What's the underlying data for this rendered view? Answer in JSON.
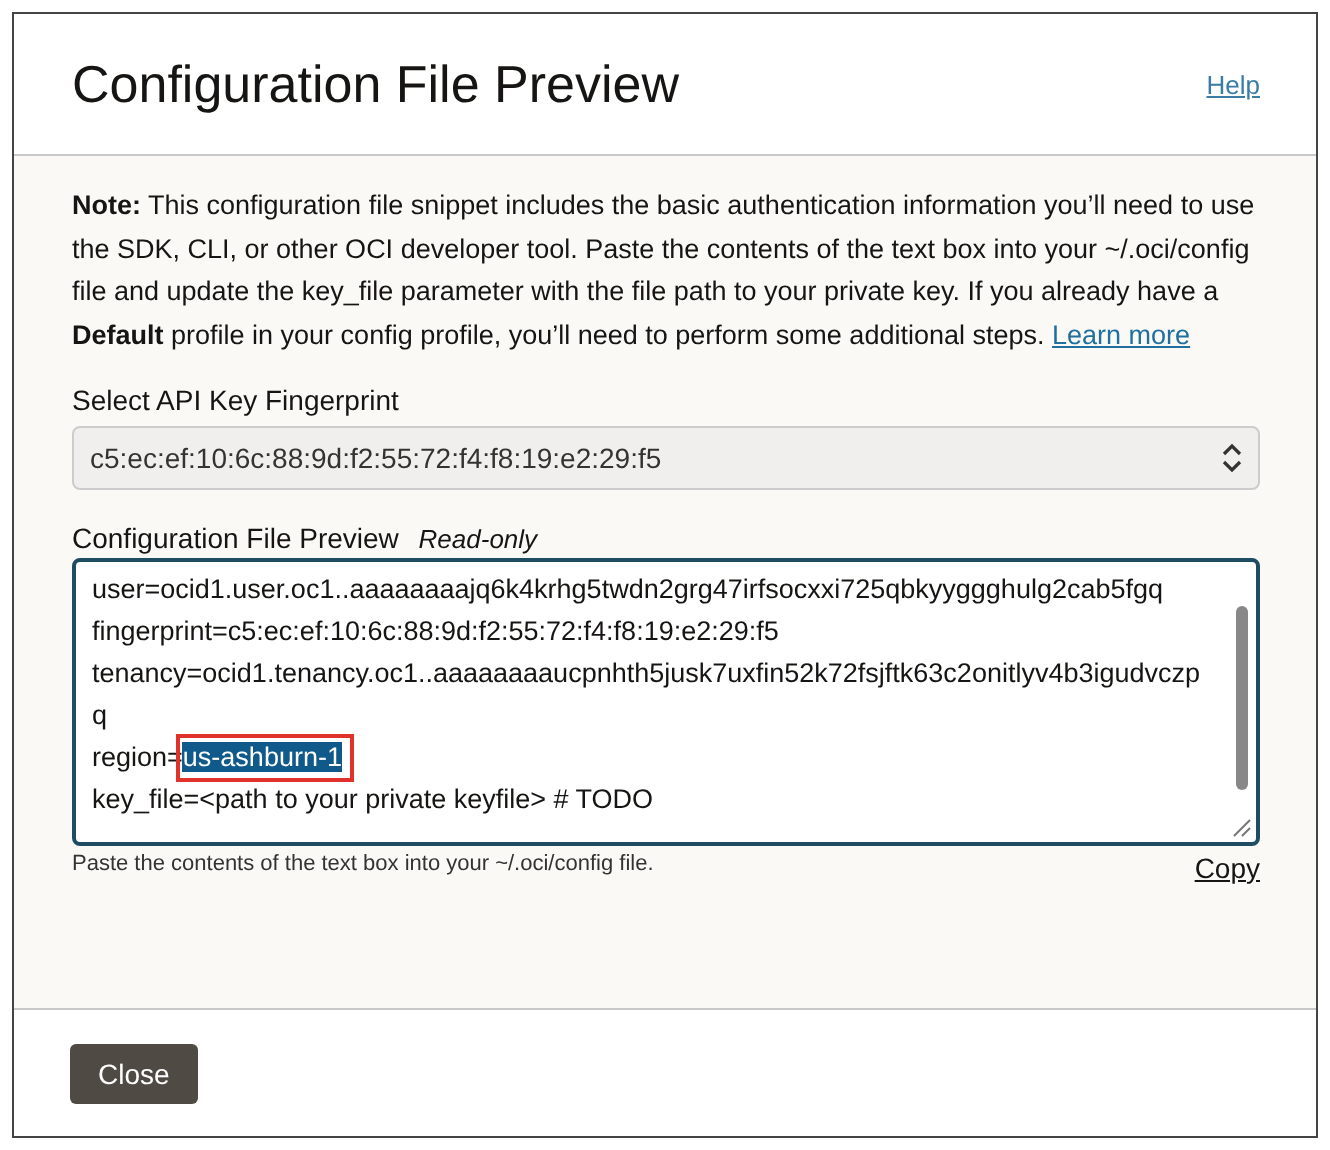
{
  "dialog": {
    "title": "Configuration File Preview",
    "help_link": "Help",
    "note": {
      "text": "**Note:** This configuration file snippet includes the basic authentication information you’ll need to use the SDK, CLI, or other OCI developer tool. Paste the contents of the text box into your ~/.oci/config file and update the key_file parameter with the file path to your private key. If you already have a **Default** profile in your config profile, you’ll need to perform some additional steps.",
      "link": "Learn more"
    },
    "fingerprint_select": {
      "label": "Select API Key Fingerprint",
      "value": "c5:ec:ef:10:6c:88:9d:f2:55:72:f4:f8:19:e2:29:f5"
    },
    "preview": {
      "label": "Configuration File Preview",
      "badge": "Read-only",
      "lines": [
        {
          "key": "user=",
          "value": "ocid1.user.oc1..aaaaaaaajq6k4krhg5twdn2grg47irfsocxxi725qbkyyggghulg2cab5fgq",
          "selected": false
        },
        {
          "key": "fingerprint=",
          "value": "c5:ec:ef:10:6c:88:9d:f2:55:72:f4:f8:19:e2:29:f5",
          "selected": false
        },
        {
          "key": "tenancy=",
          "value": "ocid1.tenancy.oc1..aaaaaaaaucpnhth5jusk7uxfin52k72fsjftk63c2onitlyv4b3igudvczpq",
          "selected": false
        },
        {
          "key": "region=",
          "value": "us-ashburn-1",
          "selected": true
        },
        {
          "key": "key_file=",
          "value": "<path to your private keyfile> # TODO",
          "selected": false
        }
      ],
      "hint": "Paste the contents of the text box into your ~/.oci/config file.",
      "copy_link": "Copy"
    },
    "buttons": [
      "Close"
    ]
  }
}
